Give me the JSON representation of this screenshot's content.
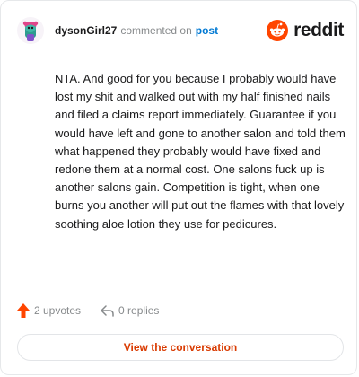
{
  "comment": {
    "username": "dysonGirl27",
    "action": "commented on",
    "target": "post",
    "text": "NTA. And good for you because I probably would have lost my shit and walked out with my half finished nails and filed a claims report immediately. Guarantee if you would have left and gone to another salon and told them what happened they probably would have fixed and redone them at a normal cost. One salons fuck up is another salons gain. Competition is tight, when one burns you another will put out the flames with that lovely soothing aloe lotion they use for pedicures."
  },
  "brand": {
    "wordmark": "reddit",
    "color": "#ff4500"
  },
  "footer": {
    "upvotes_label": "2 upvotes",
    "replies_label": "0 replies",
    "view_button": "View the conversation"
  },
  "icons": {
    "upvote": "upvote-arrow-icon",
    "reply": "reply-arrow-icon",
    "avatar": "snoo-avatar-icon"
  },
  "colors": {
    "accent": "#d93a00",
    "upvote": "#ff4500",
    "link": "#0079d3",
    "muted": "#878a8c"
  }
}
